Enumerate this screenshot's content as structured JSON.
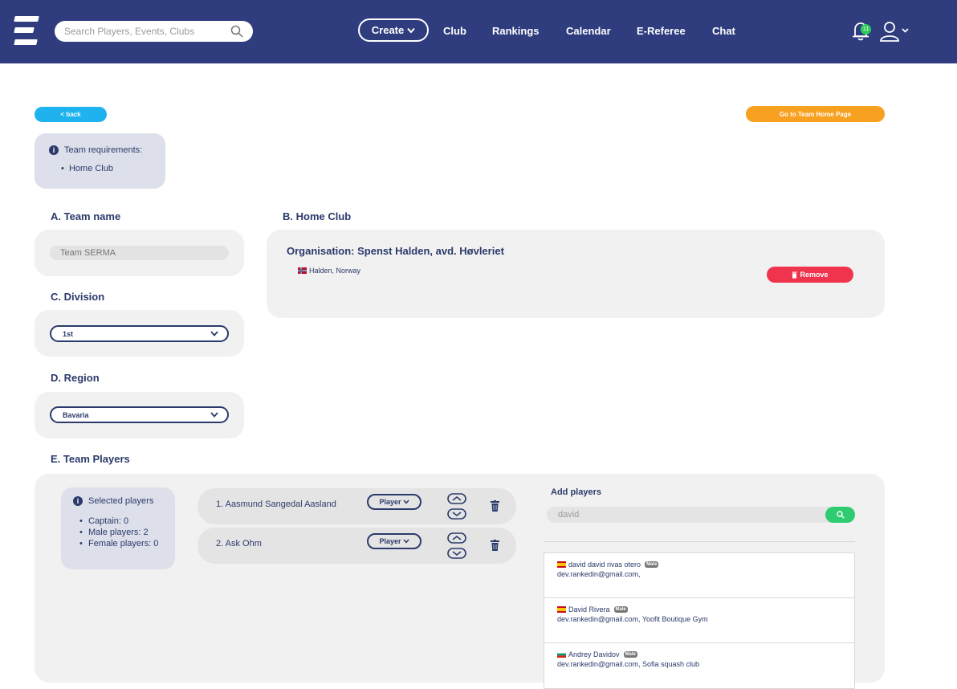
{
  "header": {
    "search_placeholder": "Search Players, Events, Clubs",
    "create_label": "Create",
    "nav": [
      "Club",
      "Rankings",
      "Calendar",
      "E-Referee",
      "Chat"
    ],
    "notification_count": "11"
  },
  "actions": {
    "back_label": "< back",
    "home_label": "Go to Team Home Page"
  },
  "requirements": {
    "title": "Team requirements:",
    "items": [
      "Home Club"
    ]
  },
  "team_name": {
    "label": "A. Team name",
    "placeholder": "Team SERMA"
  },
  "home_club": {
    "label": "B. Home Club",
    "organisation": "Organisation: Spenst Halden, avd. Høvleriet",
    "location": "Halden, Norway",
    "remove_label": "Remove"
  },
  "division": {
    "label": "C. Division",
    "value": "1st"
  },
  "region": {
    "label": "D. Region",
    "value": "Bavaria"
  },
  "team_players": {
    "label": "E. Team Players",
    "selected_title": "Selected players",
    "stats": [
      "Captain: 0",
      "Male players: 2",
      "Female players: 0"
    ],
    "players": [
      {
        "name": "1. Aasmund Sangedal Aasland",
        "role": "Player"
      },
      {
        "name": "2. Ask Ohm",
        "role": "Player"
      }
    ]
  },
  "add_players": {
    "title": "Add players",
    "search_value": "david",
    "results": [
      {
        "name": "david david rivas otero",
        "gender": "Male",
        "detail": "dev.rankedin@gmail.com,",
        "flag": "es"
      },
      {
        "name": "David Rivera",
        "gender": "Male",
        "detail": "dev.rankedin@gmail.com, Yoofit Boutique Gym",
        "flag": "es"
      },
      {
        "name": "Andrey Davidov",
        "gender": "Male",
        "detail": "dev.rankedin@gmail.com, Sofia squash club",
        "flag": "bg"
      }
    ]
  },
  "colors": {
    "header_bg": "#2f3d7e",
    "primary_text": "#2b3a6b",
    "back_btn": "#1eb3ee",
    "home_btn": "#f8a020",
    "remove_btn": "#f0344e",
    "search_go": "#2ecc71"
  }
}
